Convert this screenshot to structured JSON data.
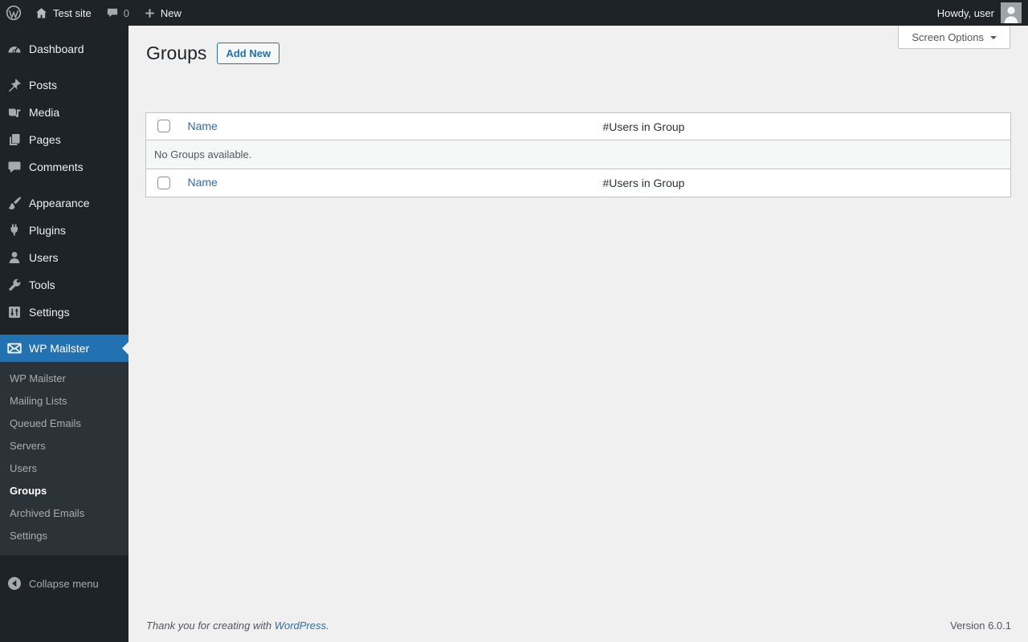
{
  "admin_bar": {
    "site_name": "Test site",
    "comment_count": "0",
    "new_label": "New",
    "howdy": "Howdy, user"
  },
  "sidebar": {
    "items": [
      {
        "label": "Dashboard",
        "icon": "dashboard-icon"
      },
      {
        "label": "Posts",
        "icon": "pushpin-icon"
      },
      {
        "label": "Media",
        "icon": "media-icon"
      },
      {
        "label": "Pages",
        "icon": "pages-icon"
      },
      {
        "label": "Comments",
        "icon": "comments-icon"
      },
      {
        "label": "Appearance",
        "icon": "paintbrush-icon"
      },
      {
        "label": "Plugins",
        "icon": "plug-icon"
      },
      {
        "label": "Users",
        "icon": "person-icon"
      },
      {
        "label": "Tools",
        "icon": "wrench-icon"
      },
      {
        "label": "Settings",
        "icon": "sliders-icon"
      },
      {
        "label": "WP Mailster",
        "icon": "envelope-icon",
        "active": true
      }
    ],
    "submenu": [
      "WP Mailster",
      "Mailing Lists",
      "Queued Emails",
      "Servers",
      "Users",
      "Groups",
      "Archived Emails",
      "Settings"
    ],
    "active_submenu": "Groups",
    "collapse_label": "Collapse menu"
  },
  "main": {
    "page_title": "Groups",
    "add_new_label": "Add New",
    "screen_options_label": "Screen Options",
    "table": {
      "columns": [
        "Name",
        "#Users in Group"
      ],
      "empty_message": "No Groups available."
    }
  },
  "footer": {
    "thanks_prefix": "Thank you for creating with ",
    "wordpress_link": "WordPress",
    "thanks_suffix": ".",
    "version": "Version 6.0.1"
  },
  "icons": {
    "wordpress-logo": "W in circle",
    "home-icon": "house",
    "comments-bubble-icon": "speech bubble",
    "plus-icon": "+",
    "avatar": "person silhouette",
    "screen-options-arrow": "▼",
    "collapse-arrow-icon": "◀ in circle",
    "active-arrow": "notch pointing left"
  },
  "colors": {
    "admin_bar_bg": "#1d2327",
    "sidebar_bg": "#1d2327",
    "submenu_bg": "#2c3338",
    "accent_blue": "#2271b1",
    "content_bg": "#f0f0f1",
    "table_border": "#c3c4c7",
    "empty_row_bg": "#f6f7f7",
    "icon_gray": "#a7aaad"
  }
}
